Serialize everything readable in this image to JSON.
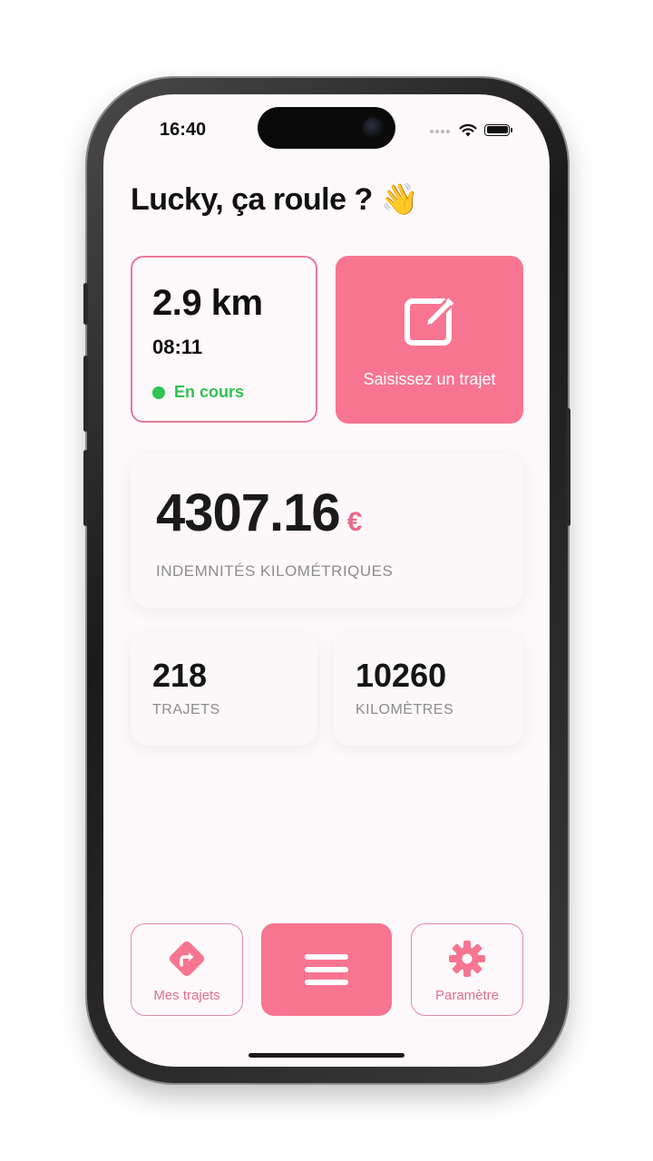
{
  "status_bar": {
    "time": "16:40"
  },
  "greeting": "Lucky, ça roule ? 👋",
  "current_trip": {
    "distance": "2.9 km",
    "time": "08:11",
    "status": "En cours",
    "status_color": "#2fc353"
  },
  "add_trip": {
    "label": "Saisissez un trajet"
  },
  "allowance": {
    "amount": "4307.16",
    "currency": "€",
    "label": "INDEMNITÉS KILOMÉTRIQUES"
  },
  "stats": {
    "trips": {
      "value": "218",
      "label": "TRAJETS"
    },
    "kilometers": {
      "value": "10260",
      "label": "KILOMÈTRES"
    }
  },
  "bottom_nav": {
    "trips_label": "Mes trajets",
    "settings_label": "Paramètre"
  },
  "colors": {
    "accent": "#f87592",
    "accent_border": "#e87a98"
  }
}
